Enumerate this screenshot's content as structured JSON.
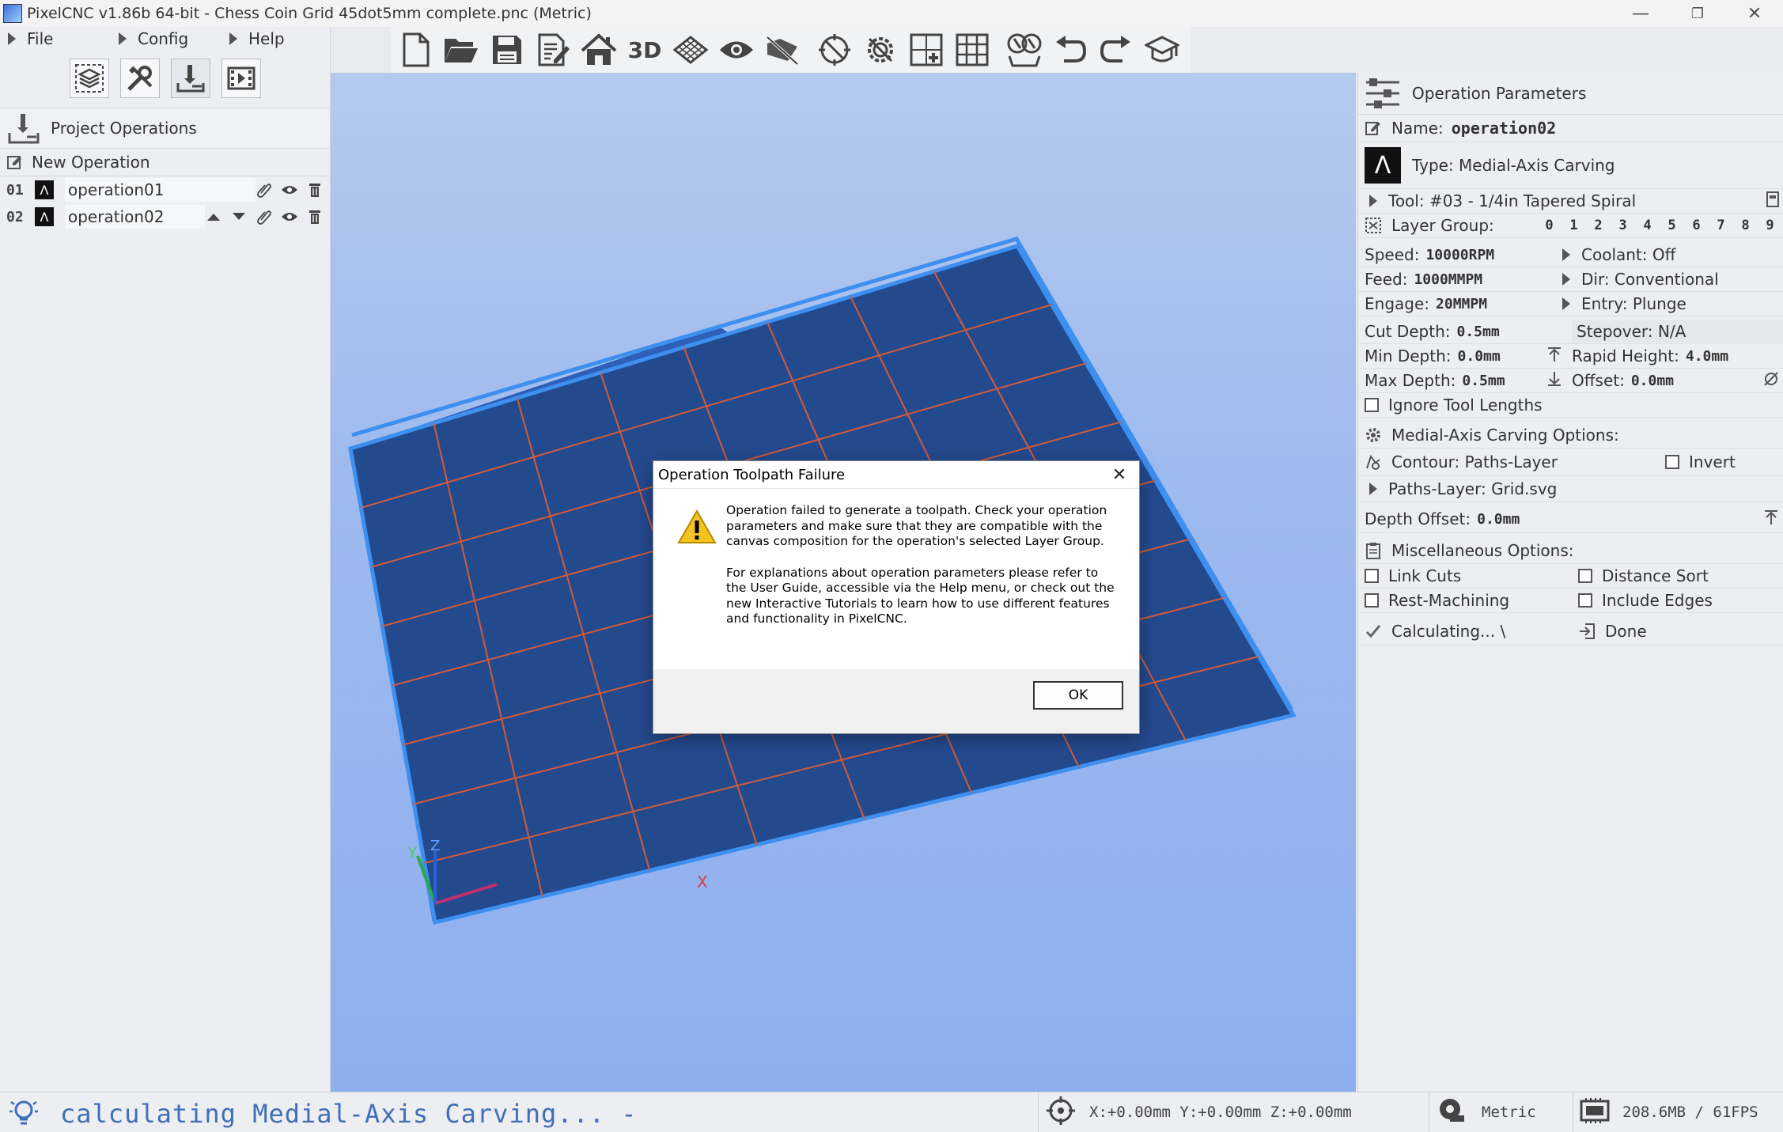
{
  "window": {
    "title": "PixelCNC v1.86b 64-bit  - Chess Coin Grid 45dot5mm complete.pnc (Metric)",
    "minimize": "—",
    "restore": "❐",
    "close": "✕"
  },
  "menu": {
    "file": "File",
    "config": "Config",
    "help": "Help"
  },
  "left_panel": {
    "section_title": "Project Operations",
    "new_operation": "New Operation",
    "operations": [
      {
        "num": "01",
        "name": "operation01"
      },
      {
        "num": "02",
        "name": "operation02"
      }
    ]
  },
  "toolbar": {
    "view_3d_label": "3D"
  },
  "right_panel": {
    "header": "Operation Parameters",
    "name_label": "Name:",
    "name_value": "operation02",
    "type_label": "Type: Medial-Axis Carving",
    "tool_label": "Tool: #03 - 1/4in Tapered Spiral",
    "layer_group_label": "Layer Group:",
    "layer_digits": [
      "0",
      "1",
      "2",
      "3",
      "4",
      "5",
      "6",
      "7",
      "8",
      "9"
    ],
    "speed_label": "Speed:",
    "speed_value": "10000RPM",
    "coolant": "Coolant: Off",
    "feed_label": "Feed:",
    "feed_value": "1000MMPM",
    "dir": "Dir: Conventional",
    "engage_label": "Engage:",
    "engage_value": "20MMPM",
    "entry": "Entry: Plunge",
    "cut_depth_label": "Cut Depth:",
    "cut_depth_value": "0.5mm",
    "stepover": "Stepover: N/A",
    "min_depth_label": "Min Depth:",
    "min_depth_value": "0.0mm",
    "rapid_height_label": "Rapid Height:",
    "rapid_height_value": "4.0mm",
    "max_depth_label": "Max Depth:",
    "max_depth_value": "0.5mm",
    "offset_label": "Offset:",
    "offset_value": "0.0mm",
    "ignore_tool_lengths": "Ignore Tool Lengths",
    "options_header": "Medial-Axis Carving Options:",
    "contour": "Contour: Paths-Layer",
    "invert": "Invert",
    "paths_layer": "Paths-Layer: Grid.svg",
    "depth_offset_label": "Depth Offset:",
    "depth_offset_value": "0.0mm",
    "misc_header": "Miscellaneous Options:",
    "link_cuts": "Link Cuts",
    "distance_sort": "Distance Sort",
    "rest_machining": "Rest-Machining",
    "include_edges": "Include Edges",
    "calculating": "Calculating... \\",
    "done": "Done"
  },
  "viewport": {
    "axis_x": "X",
    "axis_y": "Y",
    "axis_z": "Z"
  },
  "dialog": {
    "title": "Operation Toolpath Failure",
    "close": "✕",
    "message_1": "Operation failed to generate a toolpath. Check your operation parameters and make sure that they are compatible with the canvas composition for the operation's selected Layer Group.",
    "message_2": "For explanations about operation parameters please refer to the User Guide, accessible via the Help menu, or check out the new Interactive Tutorials to learn how to use different features and functionality in PixelCNC.",
    "ok": "OK"
  },
  "status": {
    "text": "calculating Medial-Axis Carving... -",
    "coords": "X:+0.00mm Y:+0.00mm Z:+0.00mm",
    "units": "Metric",
    "perf": "208.6MB / 61FPS"
  },
  "colors": {
    "accent": "#3f6fb8",
    "plate": "#244a8e",
    "plate_edge": "#3d8ff0",
    "grid_line": "#d25a3a",
    "viewport_bg": "#9ebaee"
  }
}
